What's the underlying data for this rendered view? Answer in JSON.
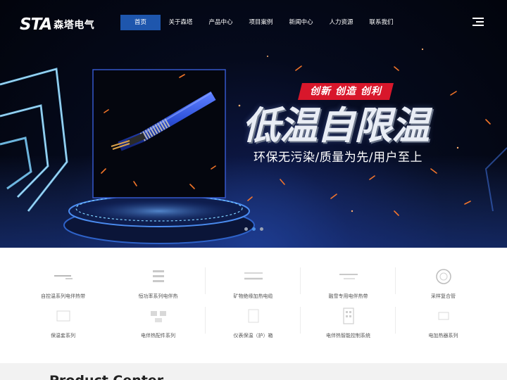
{
  "brand": {
    "mark": "STA",
    "name": "森塔电气"
  },
  "nav": {
    "items": [
      {
        "label": "首页",
        "active": true
      },
      {
        "label": "关于森塔",
        "active": false
      },
      {
        "label": "产品中心",
        "active": false
      },
      {
        "label": "项目案例",
        "active": false
      },
      {
        "label": "新闻中心",
        "active": false
      },
      {
        "label": "人力资源",
        "active": false
      },
      {
        "label": "联系我们",
        "active": false
      }
    ],
    "menu_icon": "hamburger-menu-icon"
  },
  "hero": {
    "tag": "创新 创造 创利",
    "title": "低温自限温",
    "subtitle": "环保无污染/质量为先/用户至上",
    "slides": 3,
    "active_slide": 2
  },
  "products": [
    {
      "label": "自控温系列电伴热带",
      "icon": "heating-cable-icon"
    },
    {
      "label": "恒功率系列电伴热",
      "icon": "constant-power-cable-icon"
    },
    {
      "label": "矿物绝缘加热电缆",
      "icon": "mineral-cable-icon"
    },
    {
      "label": "融雪专用电伴热带",
      "icon": "snow-melt-cable-icon"
    },
    {
      "label": "采样复合管",
      "icon": "sampling-tube-icon"
    },
    {
      "label": "保温套系列",
      "icon": "insulation-jacket-icon"
    },
    {
      "label": "电伴热配件系列",
      "icon": "accessories-icon"
    },
    {
      "label": "仪表保温（护）箱",
      "icon": "instrument-box-icon"
    },
    {
      "label": "电伴热智能控制系统",
      "icon": "control-system-icon"
    },
    {
      "label": "电加热器系列",
      "icon": "electric-heater-icon"
    }
  ],
  "section_title": "Product Center",
  "colors": {
    "nav_active": "#1e56ad",
    "tag_red": "#d8172b",
    "cable_blue": "#2c4fd6",
    "dot_active": "#4a8fe6"
  }
}
